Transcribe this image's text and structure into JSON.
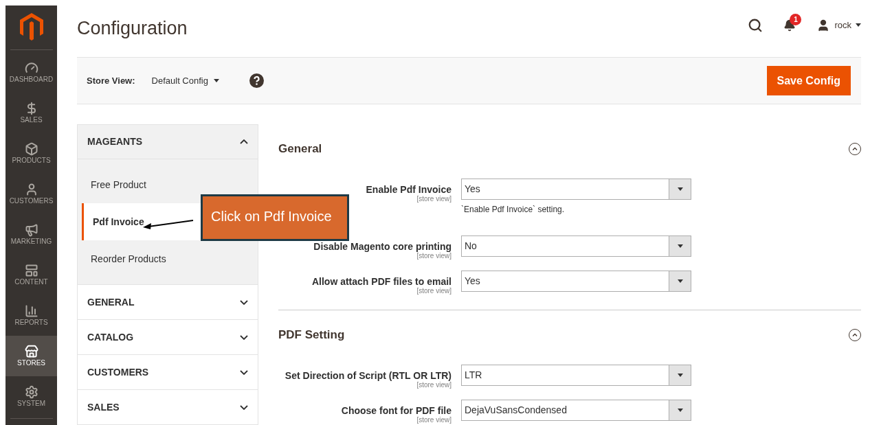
{
  "menu": [
    {
      "label": "DASHBOARD",
      "selected": false
    },
    {
      "label": "SALES",
      "selected": false
    },
    {
      "label": "PRODUCTS",
      "selected": false
    },
    {
      "label": "CUSTOMERS",
      "selected": false
    },
    {
      "label": "MARKETING",
      "selected": false
    },
    {
      "label": "CONTENT",
      "selected": false
    },
    {
      "label": "REPORTS",
      "selected": false
    },
    {
      "label": "STORES",
      "selected": true
    },
    {
      "label": "SYSTEM",
      "selected": false
    }
  ],
  "page_title": "Configuration",
  "header": {
    "notification_count": "1",
    "user": "rock"
  },
  "store_view": {
    "label": "Store View:",
    "value": "Default Config"
  },
  "save_button": "Save Config",
  "config_groups": [
    {
      "title": "MAGEANTS",
      "expanded": true,
      "items": [
        {
          "label": "Free Product",
          "selected": false
        },
        {
          "label": "Pdf Invoice",
          "selected": true
        },
        {
          "label": "Reorder Products",
          "selected": false
        }
      ]
    },
    {
      "title": "GENERAL",
      "expanded": false
    },
    {
      "title": "CATALOG",
      "expanded": false
    },
    {
      "title": "CUSTOMERS",
      "expanded": false
    },
    {
      "title": "SALES",
      "expanded": false
    }
  ],
  "sections": [
    {
      "title": "General",
      "expanded": true,
      "fields": [
        {
          "label": "Enable Pdf Invoice",
          "scope": "[store view]",
          "value": "Yes",
          "comment": "`Enable Pdf Invoice` setting."
        },
        {
          "label": "Disable Magento core printing",
          "scope": "[store view]",
          "value": "No"
        },
        {
          "label": "Allow attach PDF files to email",
          "scope": "[store view]",
          "value": "Yes"
        }
      ]
    },
    {
      "title": "PDF Setting",
      "expanded": true,
      "fields": [
        {
          "label": "Set Direction of Script (RTL OR LTR)",
          "scope": "[store view]",
          "value": "LTR"
        },
        {
          "label": "Choose font for PDF file",
          "scope": "[store view]",
          "value": "DejaVuSansCondensed"
        }
      ]
    }
  ],
  "callout": "Click on Pdf Invoice"
}
